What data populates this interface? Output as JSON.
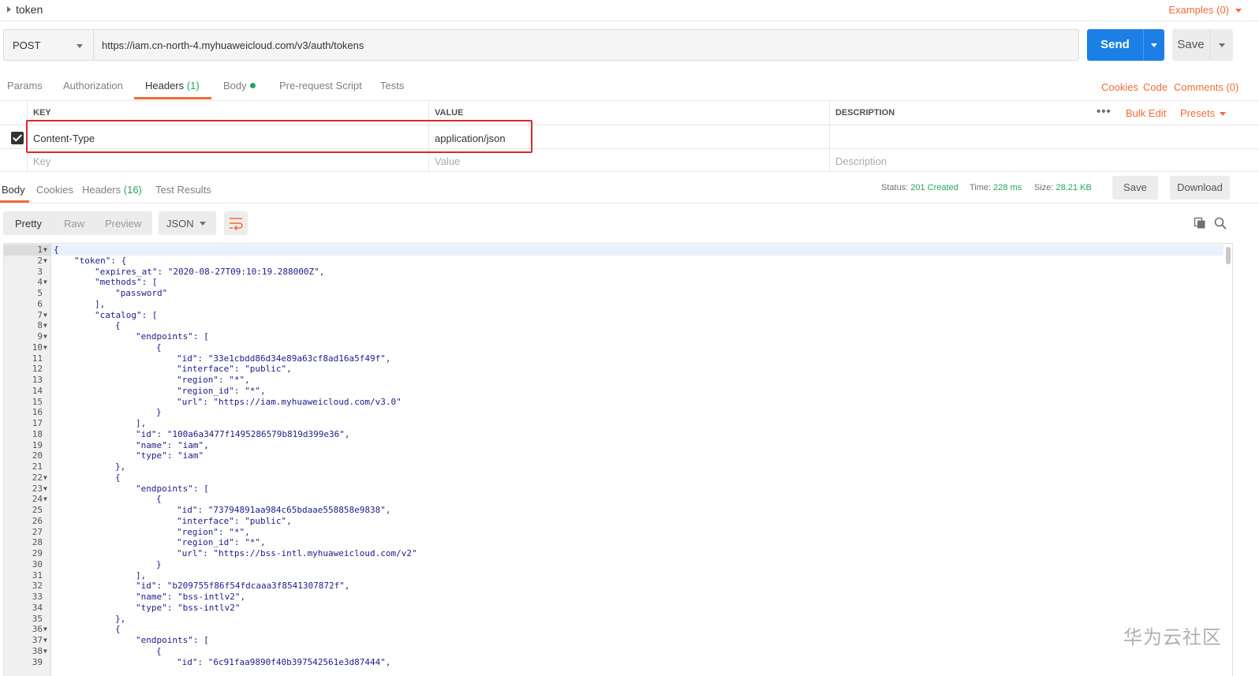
{
  "request": {
    "name": "token",
    "examples_label": "Examples (0)",
    "method": "POST",
    "url": "https://iam.cn-north-4.myhuaweicloud.com/v3/auth/tokens",
    "send_label": "Send",
    "save_label": "Save"
  },
  "request_tabs": {
    "params": "Params",
    "authorization": "Authorization",
    "headers": "Headers",
    "headers_count": "(1)",
    "body": "Body",
    "prerequest": "Pre-request Script",
    "tests": "Tests",
    "cookies": "Cookies",
    "code": "Code",
    "comments": "Comments (0)"
  },
  "headers_table": {
    "columns": {
      "key": "KEY",
      "value": "VALUE",
      "description": "DESCRIPTION"
    },
    "bulk_edit": "Bulk Edit",
    "presets": "Presets",
    "rows": [
      {
        "key": "Content-Type",
        "value": "application/json",
        "checked": true
      }
    ],
    "placeholders": {
      "key": "Key",
      "value": "Value",
      "description": "Description"
    }
  },
  "response_tabs": {
    "body": "Body",
    "cookies": "Cookies",
    "headers": "Headers",
    "headers_count": "(16)",
    "test_results": "Test Results"
  },
  "response_meta": {
    "status_label": "Status:",
    "status_value": "201 Created",
    "time_label": "Time:",
    "time_value": "228 ms",
    "size_label": "Size:",
    "size_value": "28.21 KB",
    "save_label": "Save",
    "download_label": "Download"
  },
  "view_modes": {
    "pretty": "Pretty",
    "raw": "Raw",
    "preview": "Preview",
    "format": "JSON"
  },
  "code_lines": [
    {
      "n": "1",
      "fold": true,
      "indent": 0,
      "t": "{"
    },
    {
      "n": "2",
      "fold": true,
      "indent": 1,
      "t": "\"token\": {"
    },
    {
      "n": "3",
      "fold": false,
      "indent": 2,
      "t": "\"expires_at\": \"2020-08-27T09:10:19.288000Z\","
    },
    {
      "n": "4",
      "fold": true,
      "indent": 2,
      "t": "\"methods\": ["
    },
    {
      "n": "5",
      "fold": false,
      "indent": 3,
      "t": "\"password\""
    },
    {
      "n": "6",
      "fold": false,
      "indent": 2,
      "t": "],"
    },
    {
      "n": "7",
      "fold": true,
      "indent": 2,
      "t": "\"catalog\": ["
    },
    {
      "n": "8",
      "fold": true,
      "indent": 3,
      "t": "{"
    },
    {
      "n": "9",
      "fold": true,
      "indent": 4,
      "t": "\"endpoints\": ["
    },
    {
      "n": "10",
      "fold": true,
      "indent": 5,
      "t": "{"
    },
    {
      "n": "11",
      "fold": false,
      "indent": 6,
      "t": "\"id\": \"33e1cbdd86d34e89a63cf8ad16a5f49f\","
    },
    {
      "n": "12",
      "fold": false,
      "indent": 6,
      "t": "\"interface\": \"public\","
    },
    {
      "n": "13",
      "fold": false,
      "indent": 6,
      "t": "\"region\": \"*\","
    },
    {
      "n": "14",
      "fold": false,
      "indent": 6,
      "t": "\"region_id\": \"*\","
    },
    {
      "n": "15",
      "fold": false,
      "indent": 6,
      "t": "\"url\": \"https://iam.myhuaweicloud.com/v3.0\""
    },
    {
      "n": "16",
      "fold": false,
      "indent": 5,
      "t": "}"
    },
    {
      "n": "17",
      "fold": false,
      "indent": 4,
      "t": "],"
    },
    {
      "n": "18",
      "fold": false,
      "indent": 4,
      "t": "\"id\": \"100a6a3477f1495286579b819d399e36\","
    },
    {
      "n": "19",
      "fold": false,
      "indent": 4,
      "t": "\"name\": \"iam\","
    },
    {
      "n": "20",
      "fold": false,
      "indent": 4,
      "t": "\"type\": \"iam\""
    },
    {
      "n": "21",
      "fold": false,
      "indent": 3,
      "t": "},"
    },
    {
      "n": "22",
      "fold": true,
      "indent": 3,
      "t": "{"
    },
    {
      "n": "23",
      "fold": true,
      "indent": 4,
      "t": "\"endpoints\": ["
    },
    {
      "n": "24",
      "fold": true,
      "indent": 5,
      "t": "{"
    },
    {
      "n": "25",
      "fold": false,
      "indent": 6,
      "t": "\"id\": \"73794891aa984c65bdaae558858e9838\","
    },
    {
      "n": "26",
      "fold": false,
      "indent": 6,
      "t": "\"interface\": \"public\","
    },
    {
      "n": "27",
      "fold": false,
      "indent": 6,
      "t": "\"region\": \"*\","
    },
    {
      "n": "28",
      "fold": false,
      "indent": 6,
      "t": "\"region_id\": \"*\","
    },
    {
      "n": "29",
      "fold": false,
      "indent": 6,
      "t": "\"url\": \"https://bss-intl.myhuaweicloud.com/v2\""
    },
    {
      "n": "30",
      "fold": false,
      "indent": 5,
      "t": "}"
    },
    {
      "n": "31",
      "fold": false,
      "indent": 4,
      "t": "],"
    },
    {
      "n": "32",
      "fold": false,
      "indent": 4,
      "t": "\"id\": \"b209755f86f54fdcaaa3f8541307872f\","
    },
    {
      "n": "33",
      "fold": false,
      "indent": 4,
      "t": "\"name\": \"bss-intlv2\","
    },
    {
      "n": "34",
      "fold": false,
      "indent": 4,
      "t": "\"type\": \"bss-intlv2\""
    },
    {
      "n": "35",
      "fold": false,
      "indent": 3,
      "t": "},"
    },
    {
      "n": "36",
      "fold": true,
      "indent": 3,
      "t": "{"
    },
    {
      "n": "37",
      "fold": true,
      "indent": 4,
      "t": "\"endpoints\": ["
    },
    {
      "n": "38",
      "fold": true,
      "indent": 5,
      "t": "{"
    },
    {
      "n": "39",
      "fold": false,
      "indent": 6,
      "t": "\"id\": \"6c91faa9890f40b397542561e3d87444\","
    }
  ],
  "watermark": "华为云社区",
  "colors": {
    "accent": "#f26b3a",
    "primary": "#1b7fe6",
    "success": "#26a65b",
    "highlight_box": "#e0262a"
  }
}
